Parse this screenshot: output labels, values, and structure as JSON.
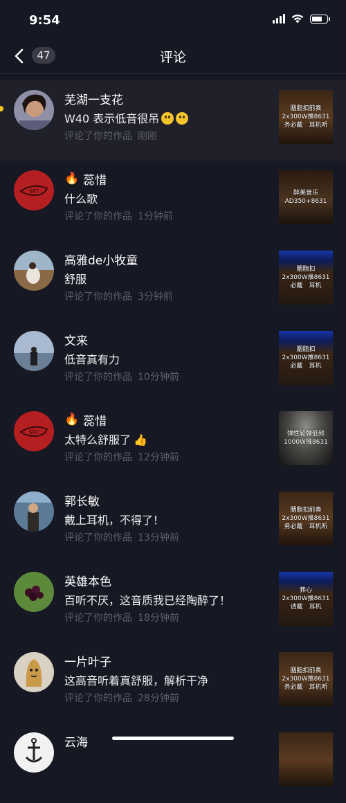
{
  "status": {
    "time": "9:54"
  },
  "header": {
    "back_count": "47",
    "title": "评论"
  },
  "comments": [
    {
      "name": "芜湖一支花",
      "fire": "",
      "text": "W40 表示低音很吊",
      "emoji": "hot-face",
      "action": "评论了你的作品",
      "time": "刚刚",
      "thumb_text": "胭脂扣前奏\n2x300W推8631\n务必戴　耳机听",
      "thumb_style": "amber"
    },
    {
      "name": "蕊惜",
      "fire": "🔥",
      "text": "什么歌",
      "emoji": "",
      "action": "评论了你的作品",
      "time": "1分钟前",
      "thumb_text": "醉美音乐\nAD350+8631",
      "thumb_style": "amber"
    },
    {
      "name": "高雅de小牧童",
      "fire": "",
      "text": "舒服",
      "emoji": "",
      "action": "评论了你的作品",
      "time": "3分钟前",
      "thumb_text": "胭脂扣\n2x300W推8631\n必戴　耳机",
      "thumb_style": "blue"
    },
    {
      "name": "文来",
      "fire": "",
      "text": "低音真有力",
      "emoji": "",
      "action": "评论了你的作品",
      "time": "10分钟前",
      "thumb_text": "胭脂扣\n2x300W推8631\n必戴　耳机",
      "thumb_style": "blue"
    },
    {
      "name": "蕊惜",
      "fire": "🔥",
      "text": "太特么舒服了",
      "emoji": "thumbs",
      "action": "评论了你的作品",
      "time": "12分钟前",
      "thumb_text": "弹性轮弹低频\n1000W推8631",
      "thumb_style": "stone"
    },
    {
      "name": "郭长敏",
      "fire": "",
      "text": "戴上耳机，不得了！",
      "emoji": "",
      "action": "评论了你的作品",
      "time": "13分钟前",
      "thumb_text": "胭脂扣前奏\n2x300W推8631\n务必戴　耳机听",
      "thumb_style": "amber"
    },
    {
      "name": "英雄本色",
      "fire": "",
      "text": "百听不厌，这音质我已经陶醉了！",
      "emoji": "",
      "action": "评论了你的作品",
      "time": "18分钟前",
      "thumb_text": "葬心\n2x300W推8631\n请戴　耳机",
      "thumb_style": "blue"
    },
    {
      "name": "一片叶子",
      "fire": "",
      "text": "这高音听着真舒服，解析干净",
      "emoji": "",
      "action": "评论了你的作品",
      "time": "28分钟前",
      "thumb_text": "胭脂扣前奏\n2x300W推8631\n务必戴　耳机听",
      "thumb_style": "amber"
    },
    {
      "name": "云海",
      "fire": "",
      "text": "",
      "emoji": "",
      "action": "",
      "time": "",
      "thumb_text": "",
      "thumb_style": "amber"
    }
  ],
  "colors": {
    "background": "#161823",
    "highlight": "#1f2029",
    "meta": "#5e5f69",
    "dot": "#f5c518"
  }
}
